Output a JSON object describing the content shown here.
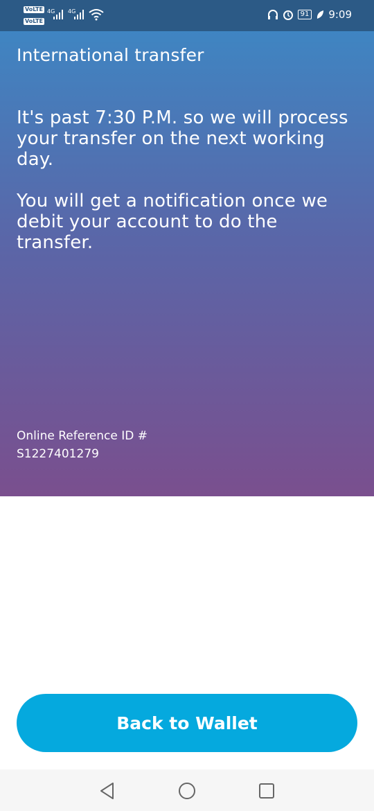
{
  "status_bar": {
    "volte_1": "VoLTE",
    "volte_2": "VoLTE",
    "net_1": "4G",
    "net_2": "4G",
    "battery": "91",
    "time": "9:09",
    "icons": [
      "signal-icon",
      "wifi-icon",
      "headphones-icon",
      "alarm-icon",
      "battery-icon",
      "leaf-icon"
    ]
  },
  "header": {
    "title": "International transfer"
  },
  "message": {
    "line_block_1": "It's past 7:30 P.M. so we will process your transfer on the next working day.",
    "line_block_2": "You will get a notification once we debit your account to do the transfer."
  },
  "reference": {
    "label": "Online Reference ID #",
    "value": "S1227401279"
  },
  "actions": {
    "back_label": "Back to Wallet"
  },
  "colors": {
    "status_bar": "#2c5a86",
    "gradient_top": "#3f85c2",
    "gradient_bottom": "#7a4f8e",
    "button": "#05a9de",
    "nav_icons": "#666666"
  },
  "nav": {
    "icons": [
      "back-icon",
      "home-icon",
      "recents-icon"
    ]
  }
}
